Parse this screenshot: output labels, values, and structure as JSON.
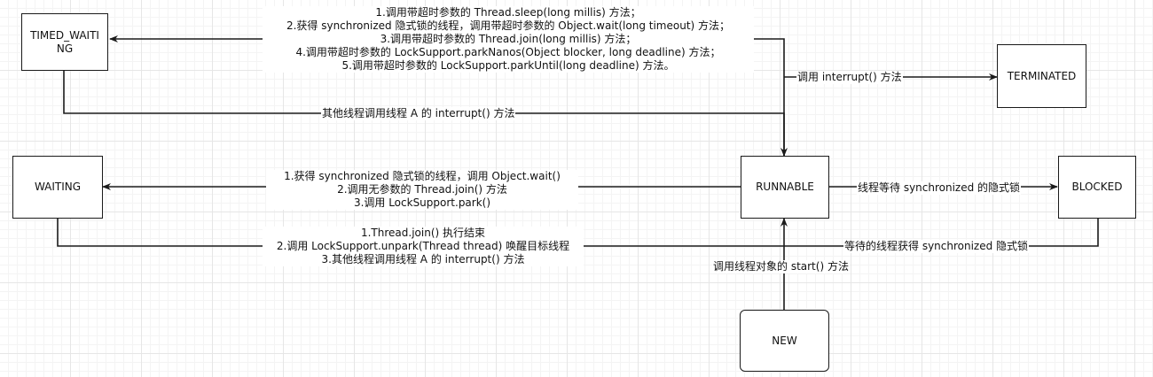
{
  "nodes": {
    "timed_waiting": "TIMED_WAITING",
    "terminated": "TERMINATED",
    "waiting": "WAITING",
    "runnable": "RUNNABLE",
    "blocked": "BLOCKED",
    "new": "NEW"
  },
  "edges": {
    "to_timed_waiting": [
      "1.调用带超时参数的 Thread.sleep(long millis) 方法；",
      "2.获得 synchronized 隐式锁的线程，调用带超时参数的 Object.wait(long timeout) 方法；",
      "3.调用带超时参数的 Thread.join(long millis) 方法；",
      "4.调用带超时参数的 LockSupport.parkNanos(Object blocker, long deadline) 方法；",
      "5.调用带超时参数的 LockSupport.parkUntil(long deadline) 方法。"
    ],
    "to_terminated": "调用 interrupt() 方法",
    "timed_waiting_to_runnable": "其他线程调用线程 A 的 interrupt() 方法",
    "to_waiting": [
      "1.获得 synchronized 隐式锁的线程，调用 Object.wait()",
      "2.调用无参数的 Thread.join() 方法",
      "3.调用 LockSupport.park()"
    ],
    "waiting_to_runnable": [
      "1.Thread.join() 执行结束",
      "2.调用 LockSupport.unpark(Thread thread) 唤醒目标线程",
      "3.其他线程调用线程 A 的 interrupt() 方法"
    ],
    "to_blocked": "线程等待 synchronized 的隐式锁",
    "blocked_to_runnable": "等待的线程获得 synchronized 隐式锁",
    "new_to_runnable": "调用线程对象的 start() 方法"
  },
  "colors": {
    "stroke": "#1a1a1a",
    "grid": "#e6e6e6",
    "background": "#ffffff"
  }
}
